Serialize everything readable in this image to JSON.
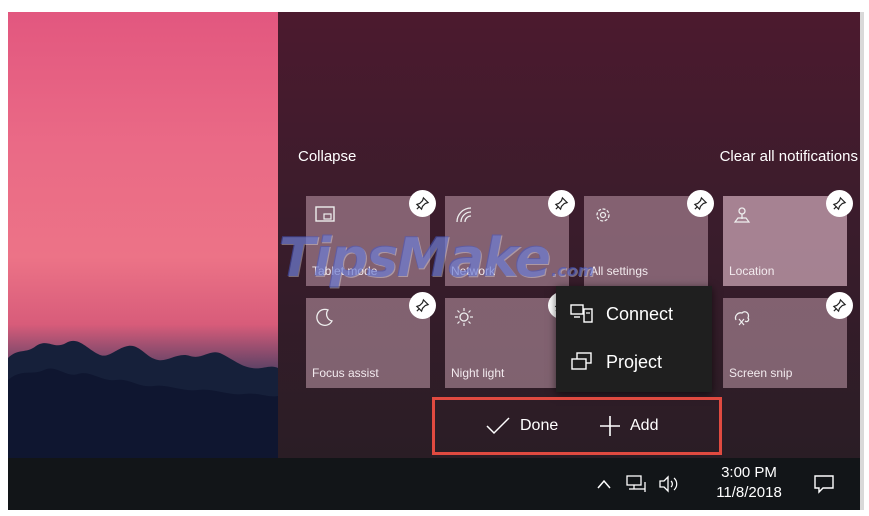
{
  "action_center": {
    "collapse_label": "Collapse",
    "clear_all_label": "Clear all notifications",
    "tiles": [
      {
        "label": "Tablet mode",
        "icon": "tablet-mode-icon"
      },
      {
        "label": "Network",
        "icon": "network-icon"
      },
      {
        "label": "All settings",
        "icon": "gear-icon"
      },
      {
        "label": "Location",
        "icon": "location-icon"
      },
      {
        "label": "Focus assist",
        "icon": "moon-icon"
      },
      {
        "label": "Night light",
        "icon": "sun-icon"
      },
      {
        "label": "Screen snip",
        "icon": "screen-snip-icon"
      }
    ],
    "add_menu": [
      {
        "label": "Connect",
        "icon": "connect-icon"
      },
      {
        "label": "Project",
        "icon": "project-icon"
      }
    ],
    "done_label": "Done",
    "add_label": "Add"
  },
  "watermark": {
    "text": "TipsMake",
    "suffix": ".com"
  },
  "taskbar": {
    "time": "3:00 PM",
    "date": "11/8/2018",
    "tray_icons": [
      "chevron-up-icon",
      "network-icon",
      "volume-icon"
    ],
    "notification_icon": "action-center-icon"
  },
  "colors": {
    "highlight_border": "#e04a40",
    "tile_bg": "#b28c9c",
    "menu_bg": "#1f1f1f",
    "taskbar_bg": "#121518"
  }
}
